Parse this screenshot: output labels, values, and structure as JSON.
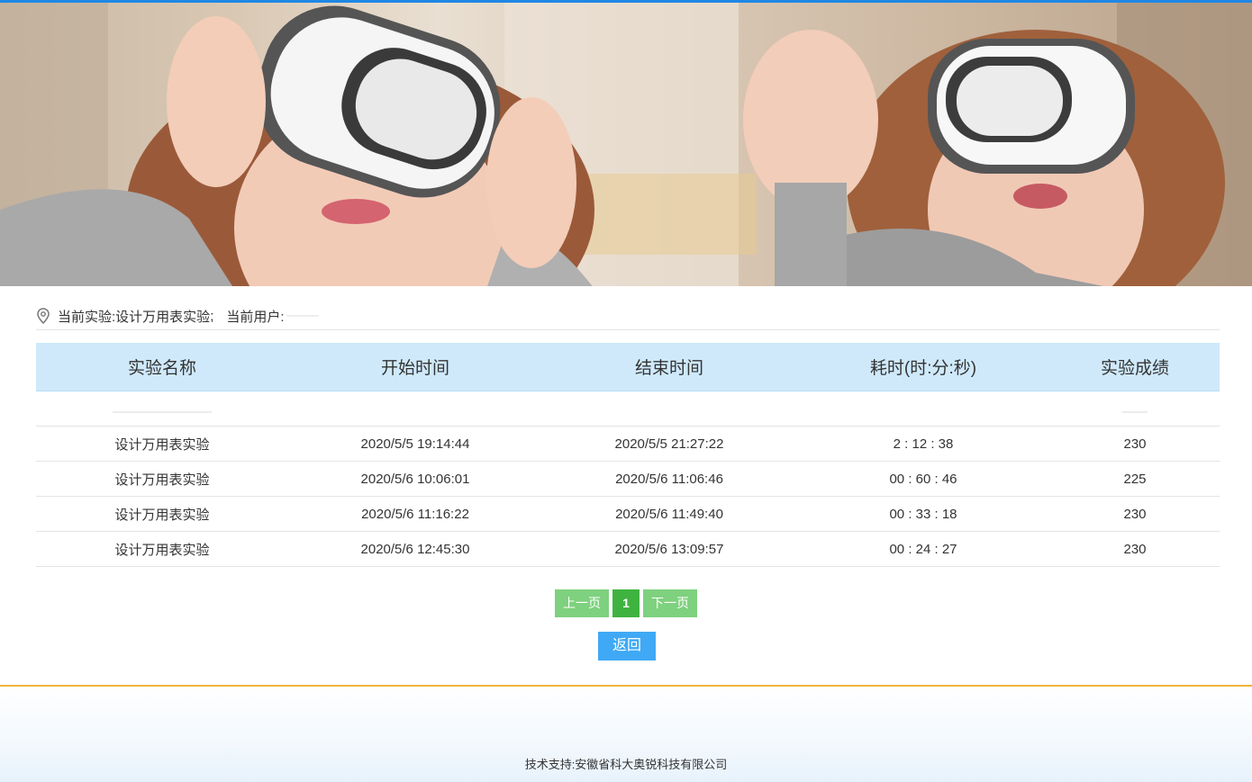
{
  "location": {
    "experiment_label": "当前实验:",
    "experiment_name": "设计万用表实验",
    "separator": ";",
    "user_label": "当前用户:",
    "icon": "location-pin-icon"
  },
  "table": {
    "headers": [
      "实验名称",
      "开始时间",
      "结束时间",
      "耗时(时:分:秒)",
      "实验成绩"
    ],
    "rows": [
      {
        "name": "设计万用表实验",
        "start": "2020/5/5 19:14:44",
        "end": "2020/5/5 21:27:22",
        "duration": "2 : 12 : 38",
        "score": "230"
      },
      {
        "name": "设计万用表实验",
        "start": "2020/5/6 10:06:01",
        "end": "2020/5/6 11:06:46",
        "duration": "00 : 60 : 46",
        "score": "225"
      },
      {
        "name": "设计万用表实验",
        "start": "2020/5/6 11:16:22",
        "end": "2020/5/6 11:49:40",
        "duration": "00 : 33 : 18",
        "score": "230"
      },
      {
        "name": "设计万用表实验",
        "start": "2020/5/6 12:45:30",
        "end": "2020/5/6 13:09:57",
        "duration": "00 : 24 : 27",
        "score": "230"
      }
    ]
  },
  "pager": {
    "prev_label": "上一页",
    "current_page": "1",
    "next_label": "下一页"
  },
  "back_label": "返回",
  "footer": {
    "support_text": "技术支持:安徽省科大奥锐科技有限公司"
  },
  "colors": {
    "header_bg": "#cfe9fb",
    "pager_green": "#7ed17e",
    "pager_active": "#3fb33f",
    "back_blue": "#3fa9f5",
    "footer_line": "#f0b43c"
  }
}
